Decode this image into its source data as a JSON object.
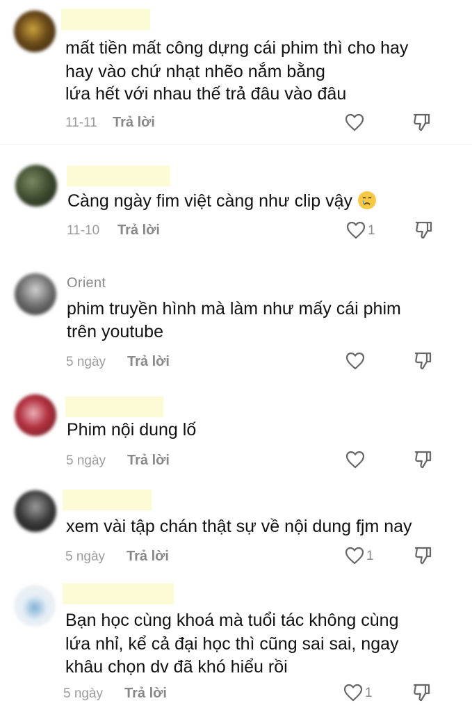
{
  "comments": [
    {
      "username": "",
      "lines": [
        "mất tiền mất công dựng cái phim thì cho hay",
        "hay vào chứ nhạt nhẽo nắm bằng",
        "lứa hết với nhau thế trả đâu vào đâu"
      ],
      "date": "11-11",
      "reply_label": "Trả lời",
      "likes": ""
    },
    {
      "username": "",
      "lines": [
        "Càng ngày fim việt càng như clip vậy"
      ],
      "date": "11-10",
      "reply_label": "Trả lời",
      "likes": "1",
      "emoji": "crying-face-emoji"
    },
    {
      "username": "Orient",
      "lines": [
        "phim truyền hình mà làm như mấy cái phim",
        "trên youtube"
      ],
      "date": "5 ngày",
      "reply_label": "Trả lời",
      "likes": ""
    },
    {
      "username": "",
      "lines": [
        "Phim nội dung lố"
      ],
      "date": "5 ngày",
      "reply_label": "Trả lời",
      "likes": ""
    },
    {
      "username": "",
      "lines": [
        "xem vài tập chán thật sự về nội dung fjm nay"
      ],
      "date": "5 ngày",
      "reply_label": "Trả lời",
      "likes": "1"
    },
    {
      "username": "",
      "lines": [
        "Bạn học cùng khoá mà tuổi tác không cùng",
        "lứa nhỉ, kể cả đại học thì cũng sai sai, ngay",
        "khâu chọn dv đã khó hiểu rồi"
      ],
      "date": "5 ngày",
      "reply_label": "Trả lời",
      "likes": "1"
    }
  ],
  "icons": {
    "like": "heart-outline-icon",
    "dislike": "thumbs-down-outline-icon"
  },
  "colors": {
    "redaction": "#fdfbd6",
    "meta_text": "#888888"
  }
}
